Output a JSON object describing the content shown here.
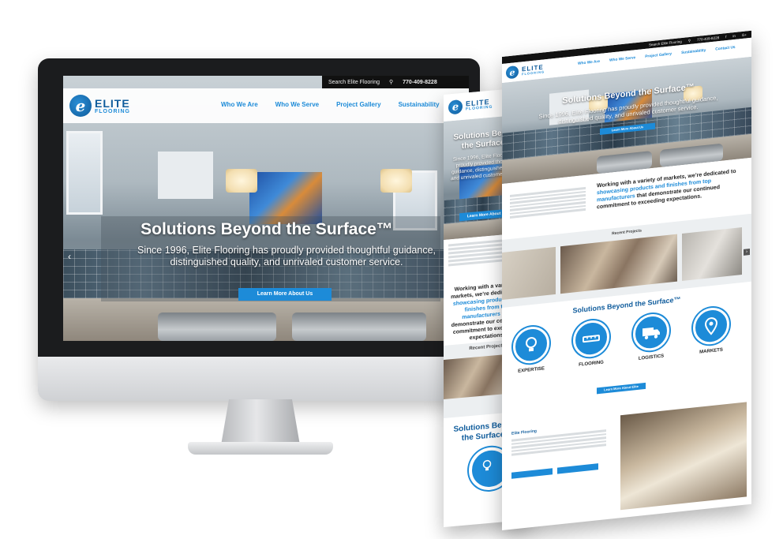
{
  "brand": {
    "mark": "e",
    "line1": "ELITE",
    "line2": "FLOORING"
  },
  "desktop": {
    "search_placeholder": "Search Elite Flooring",
    "phone": "770-409-8228",
    "nav": [
      "Who We Are",
      "Who We Serve",
      "Project Gallery",
      "Sustainability"
    ],
    "hero_title": "Solutions Beyond the Surface™",
    "hero_subtitle": "Since 1996, Elite Flooring has proudly provided thoughtful guidance, distinguished quality, and unrivaled customer service.",
    "hero_button": "Learn More About Us",
    "prev_arrow": "‹"
  },
  "tablet": {
    "menu_icon": "☰",
    "hero_title": "Solutions Beyond the Surface™",
    "hero_subtitle": "Since 1996, Elite Flooring has proudly provided thoughtful guidance, distinguished quality, and unrivaled customer service.",
    "hero_button": "Learn More About Us",
    "markets_pre": "Working with a variety of markets, we’re dedicated to ",
    "markets_highlight": "showcasing products and finishes from top manufacturers",
    "markets_post": " that demonstrate our continued commitment to exceeding expectations.",
    "recent_projects": "Recent Projects",
    "solutions_title": "Solutions Beyond the Surface™"
  },
  "page": {
    "search_placeholder": "Search Elite Flooring",
    "phone": "770-409-8228",
    "nav": [
      "Who We Are",
      "Who We Serve",
      "Project Gallery",
      "Sustainability",
      "Contact Us"
    ],
    "hero_title": "Solutions Beyond the Surface™",
    "hero_subtitle": "Since 1996, Elite Flooring has proudly provided thoughtful guidance, distinguished quality, and unrivaled customer service.",
    "hero_button": "Learn More About Us",
    "markets_pre": "Working with a variety of markets, we’re dedicated to ",
    "markets_highlight": "showcasing products and finishes from top manufacturers",
    "markets_post": " that demonstrate our continued commitment to exceeding expectations.",
    "recent_projects": "Recent Projects",
    "solutions_title": "Solutions Beyond the Surface™",
    "services": [
      {
        "title": "EXPERTISE",
        "icon": "lightbulb-icon"
      },
      {
        "title": "FLOORING",
        "icon": "measuring-tape-icon"
      },
      {
        "title": "LOGISTICS",
        "icon": "truck-icon"
      },
      {
        "title": "MARKETS",
        "icon": "map-pin-icon"
      }
    ],
    "learn_more_elite": "Learn More About Elite",
    "elite_flooring_heading": "Elite Flooring",
    "next_arrow": "›"
  },
  "colors": {
    "brand_blue": "#1d8bd8",
    "brand_navy": "#0f5c9c",
    "topbar": "#111111"
  }
}
